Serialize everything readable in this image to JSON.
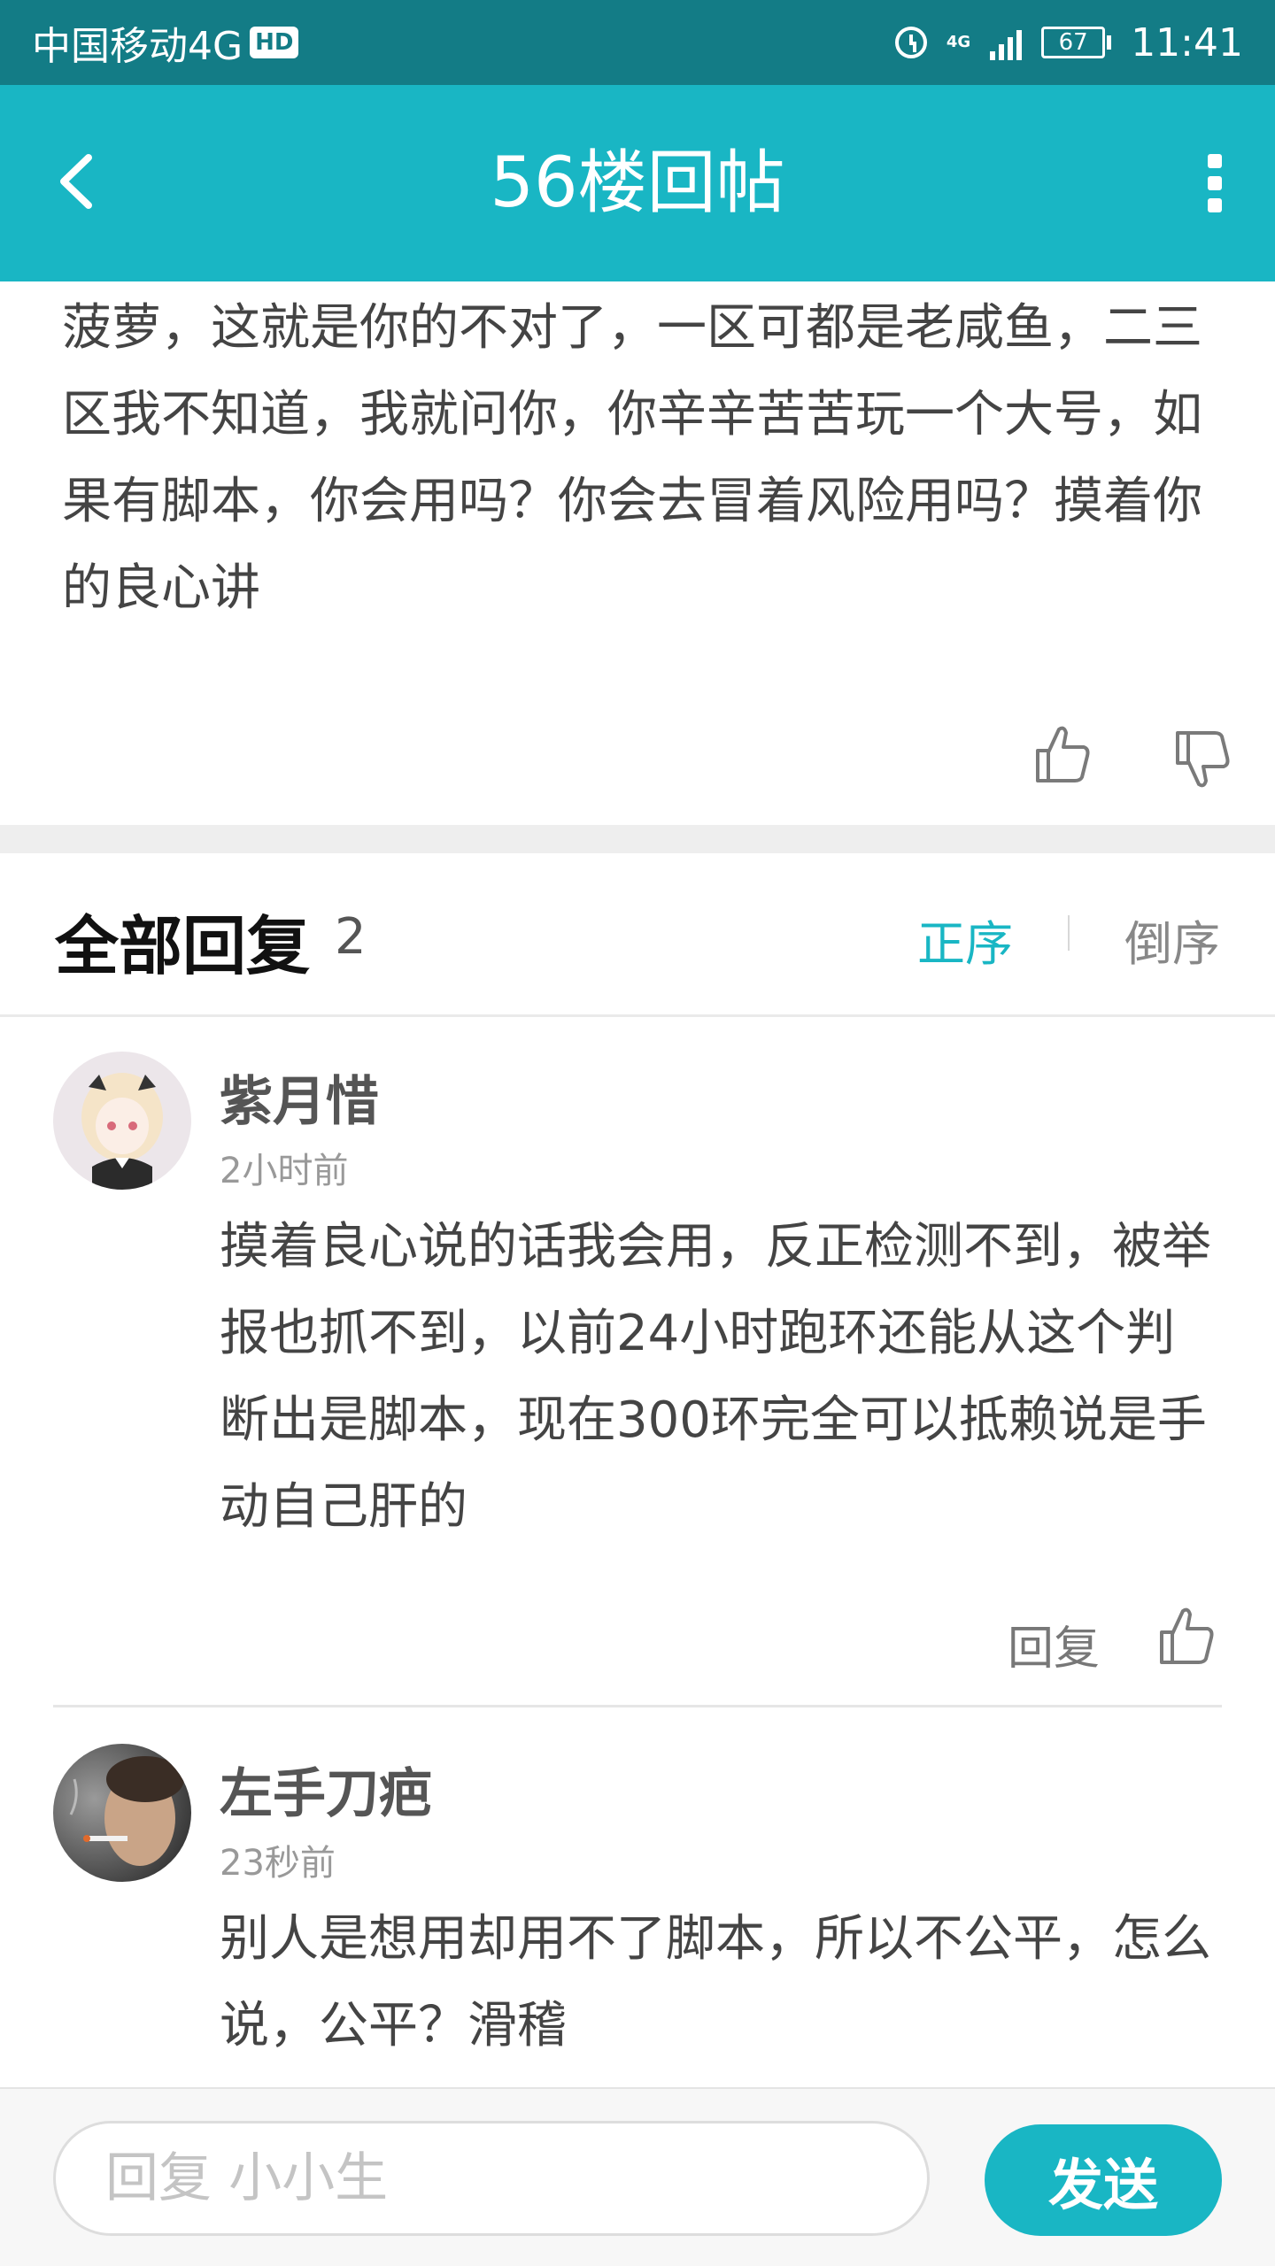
{
  "status_bar": {
    "carrier": "中国移动4G",
    "hd_badge": "HD",
    "network_label": "4G",
    "battery": "67",
    "time": "11:41"
  },
  "header": {
    "title": "56楼回帖",
    "back_icon": "chevron-left-icon",
    "more_icon": "more-vertical-icon"
  },
  "post": {
    "text": "菠萝，这就是你的不对了，一区可都是老咸鱼，二三区我不知道，我就问你，你辛辛苦苦玩一个大号，如果有脚本，你会用吗？你会去冒着风险用吗？摸着你的良心讲",
    "like_icon": "thumbs-up-icon",
    "dislike_icon": "thumbs-down-icon"
  },
  "replies": {
    "title": "全部回复",
    "count": "2",
    "sort_asc": "正序",
    "sort_desc": "倒序",
    "items": [
      {
        "user": "紫月惜",
        "time": "2小时前",
        "text": "摸着良心说的话我会用，反正检测不到，被举报也抓不到，以前24小时跑环还能从这个判断出是脚本，现在300环完全可以抵赖说是手动自己肝的",
        "reply_label": "回复"
      },
      {
        "user": "左手刀疤",
        "time": "23秒前",
        "text": "别人是想用却用不了脚本，所以不公平，怎么说，公平？滑稽"
      }
    ]
  },
  "bottom": {
    "input_placeholder": "回复 小小生",
    "send_label": "发送"
  },
  "colors": {
    "accent": "#19b6c4",
    "status_bar": "#137c86"
  }
}
